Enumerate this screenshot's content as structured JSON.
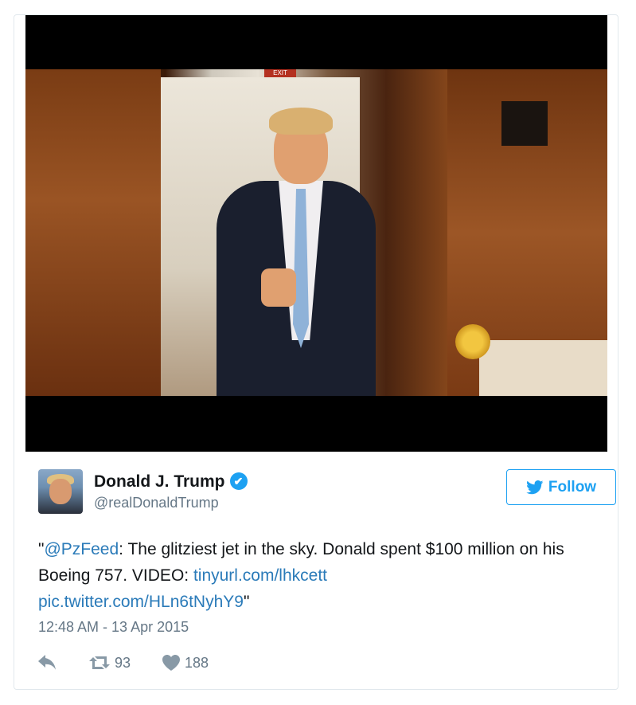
{
  "media": {
    "exit_text": "EXIT"
  },
  "author": {
    "name": "Donald J. Trump",
    "handle": "@realDonaldTrump",
    "verified_glyph": "✔"
  },
  "follow_button": {
    "label": "Follow",
    "icon": "twitter-bird-icon"
  },
  "tweet": {
    "open_quote": "\"",
    "mention": "@PzFeed",
    "text_part1": ": The glitziest jet in the sky. Donald spent $100 million on his Boeing 757. VIDEO: ",
    "link": "tinyurl.com/lhkcett",
    "pic_link": "pic.twitter.com/HLn6tNyhY9",
    "close_quote": "\""
  },
  "timestamp": "12:48 AM - 13 Apr 2015",
  "actions": {
    "reply_icon": "reply-icon",
    "retweet_count": "93",
    "like_count": "188"
  },
  "colors": {
    "link": "#2b7bb9",
    "accent": "#1da1f2",
    "muted": "#657786"
  }
}
